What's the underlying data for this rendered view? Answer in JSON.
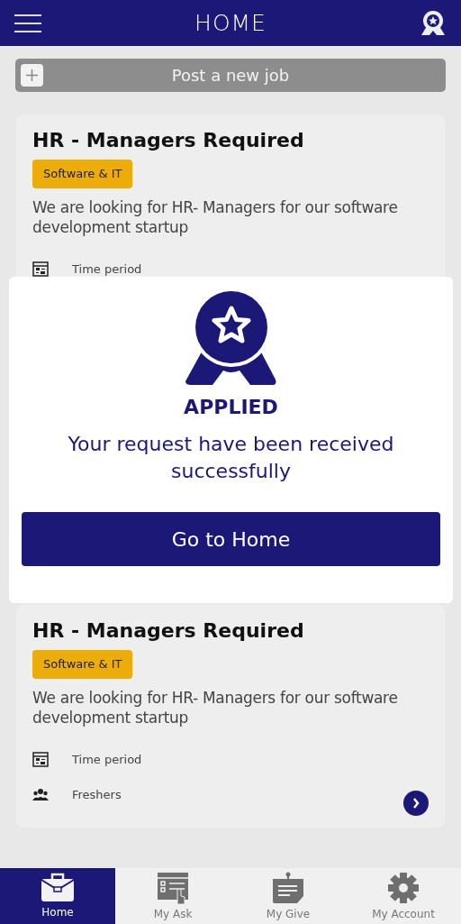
{
  "header": {
    "title": "HOME"
  },
  "post_button": {
    "label": "Post a new job"
  },
  "jobs": [
    {
      "title": "HR - Managers Required",
      "tag": "Software & IT",
      "description": "We are looking for HR- Managers for our software development startup",
      "details": [
        {
          "kind": "time",
          "text": "Time period"
        }
      ],
      "arrow": false
    },
    {
      "title": "HR - Managers Required",
      "tag": "Software & IT",
      "description": "We are looking for HR- Managers for our software development startup",
      "details": [
        {
          "kind": "time",
          "text": "Time period"
        },
        {
          "kind": "people",
          "text": "Freshers"
        }
      ],
      "arrow": true
    }
  ],
  "dialog": {
    "status": "APPLIED",
    "message": "Your request have been received successfully",
    "button": "Go to Home"
  },
  "bottom_nav": [
    {
      "label": "Home",
      "kind": "briefcase",
      "selected": true
    },
    {
      "label": "My Ask",
      "kind": "checklist",
      "selected": false
    },
    {
      "label": "My Give",
      "kind": "note",
      "selected": false
    },
    {
      "label": "My Account",
      "kind": "gear",
      "selected": false
    }
  ]
}
